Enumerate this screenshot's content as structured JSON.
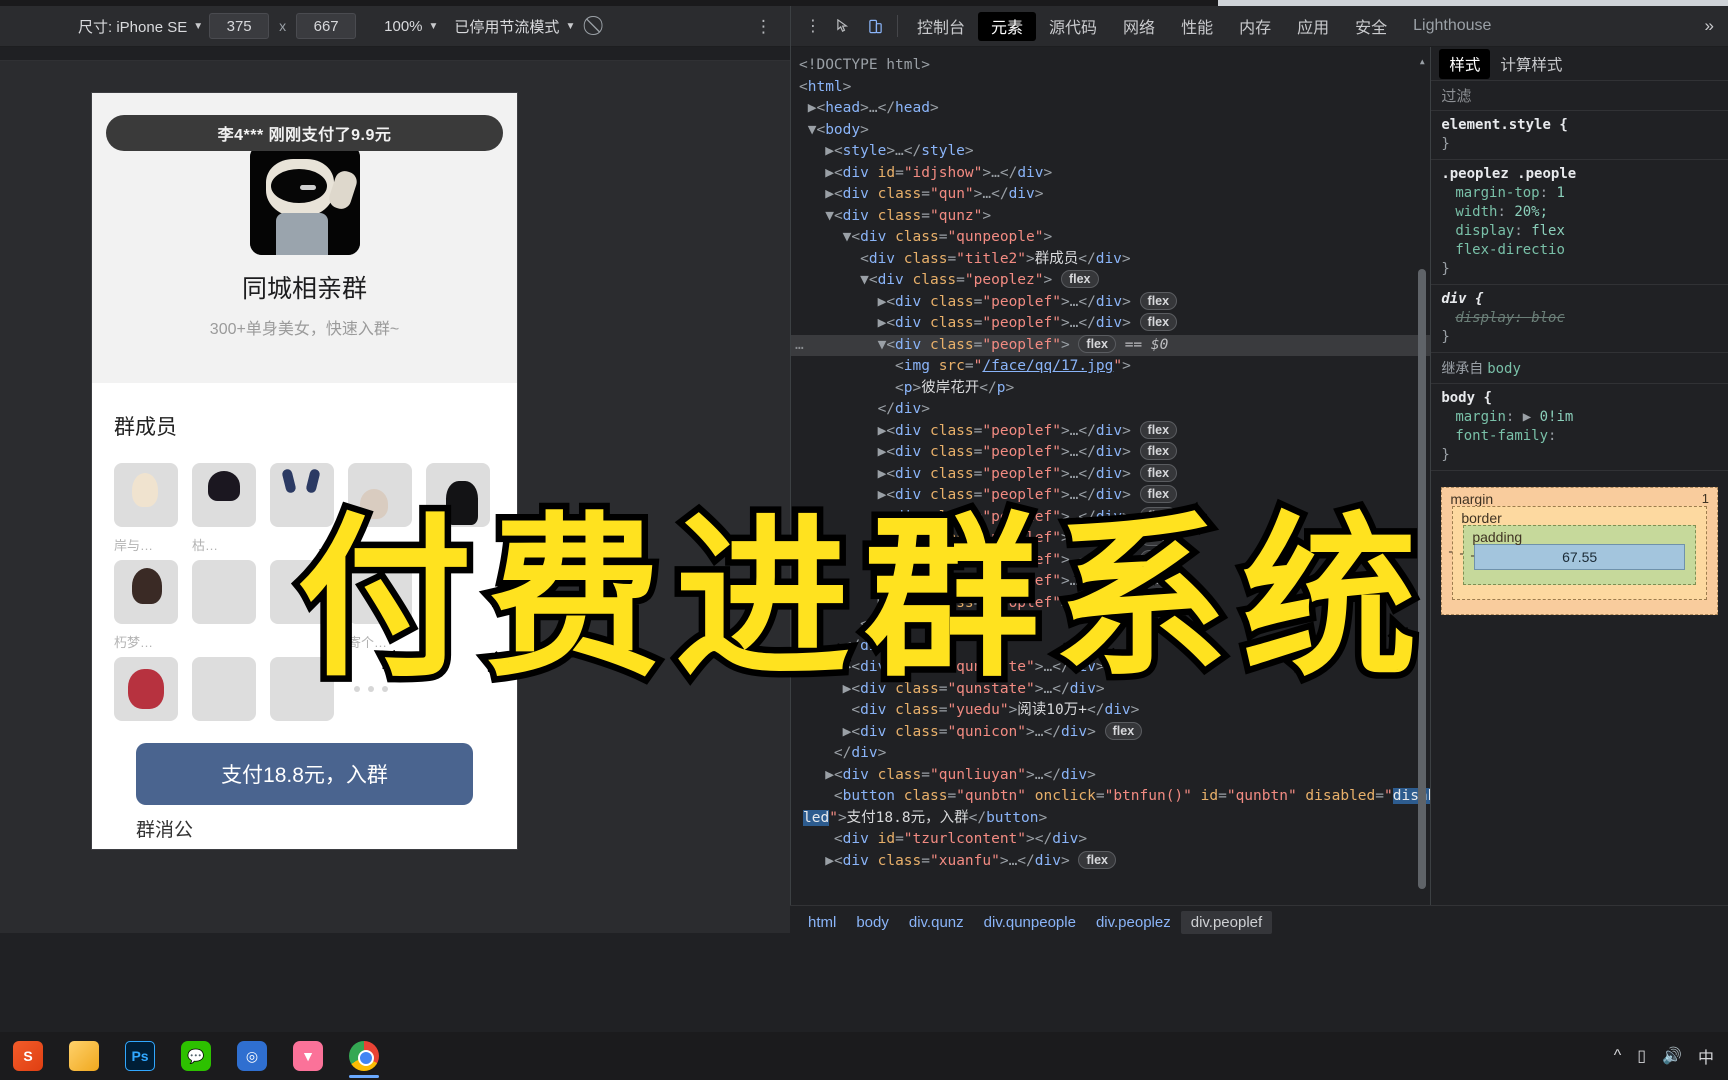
{
  "device_toolbar": {
    "size_label": "尺寸: iPhone SE",
    "width": "375",
    "x_symbol": "x",
    "height": "667",
    "zoom": "100%",
    "throttling": "已停用节流模式",
    "rotate_icon": "rotate-icon",
    "menu_icon": "kebab-menu-icon"
  },
  "devtools": {
    "inspect_icon": "inspect-element-icon",
    "device_icon": "toggle-device-toolbar-icon",
    "tabs": [
      {
        "label": "控制台",
        "selected": false
      },
      {
        "label": "元素",
        "selected": true
      },
      {
        "label": "源代码",
        "selected": false
      },
      {
        "label": "网络",
        "selected": false
      },
      {
        "label": "性能",
        "selected": false
      },
      {
        "label": "内存",
        "selected": false
      },
      {
        "label": "应用",
        "selected": false
      },
      {
        "label": "安全",
        "selected": false
      }
    ],
    "lighthouse_tab": "Lighthouse",
    "more_tabs_icon": "chevron-right-icon",
    "breadcrumb": [
      "html",
      "body",
      "div.qunz",
      "div.qunpeople",
      "div.peoplez",
      "div.peoplef"
    ],
    "breadcrumb_active": "div.peoplef"
  },
  "dom": {
    "lines": [
      "<!DOCTYPE html>",
      "<html>",
      "<head>…</head>",
      "<body>",
      "<style>…</style>",
      "<div id=\"idjshow\">…</div>",
      "<div class=\"qun\">…</div>",
      "<div class=\"qunz\">",
      "<div class=\"qunpeople\">",
      "<div class=\"title2\">群成员</div>",
      "<div class=\"peoplez\"> flex",
      "<div class=\"peoplef\">…</div> flex",
      "<div class=\"peoplef\">…</div> flex",
      "<div class=\"peoplef\"> flex == $0",
      "<img src=\"/face/qq/17.jpg\">",
      "<p>彼岸花开</p>",
      "</div>",
      "<div class=\"peoplef\">…</div> flex",
      "<div class=\"peoplef\">…</div> flex",
      "<div class=\"peoplef\">…</div> flex",
      "<div class=\"peoplef\">…</div> flex",
      "<div class=\"peoplef\">…</div> flex",
      "<div class=\"peoplef\">…</div> flex",
      "<div class=\"peoplef\">…</div> flex",
      "<div class=\"peoplef\">…</div> flex",
      "<div class=\"peoplef\">…</div> flex",
      "</div>",
      "</div>",
      "<div class=\"qunstate\">…</div>",
      "<div class=\"qunstate\">…</div>",
      "<div class=\"yuedu\">阅读10万+</div>",
      "<div class=\"qunicon\">…</div> flex",
      "</div>",
      "<div class=\"qunliuyan\">…</div>",
      "<button class=\"qunbtn\" onclick=\"btnfun()\" id=\"qunbtn\" disabled=\"disabled\">支付18.8元，入群</button>",
      "<div id=\"tzurlcontent\"></div>",
      "<div class=\"xuanfu\">…</div> flex"
    ],
    "selected_text": "<div class=\"peoplef\">",
    "img_src": "/face/qq/17.jpg",
    "p_text": "彼岸花开",
    "title2_text": "群成员",
    "yuedu_text": "阅读10万+",
    "button_text": "支付18.8元，入群",
    "button_disabled_value": "disabled",
    "flex_badge": "flex",
    "dollar_zero": "== $0"
  },
  "styles": {
    "tabs": [
      {
        "label": "样式",
        "selected": true
      },
      {
        "label": "计算样式",
        "selected": false
      }
    ],
    "filter_placeholder": "过滤",
    "rules": [
      {
        "selector": "element.style {",
        "props": [],
        "close": "}"
      },
      {
        "selector": ".peoplez .people",
        "props": [
          {
            "name": "margin-top",
            "value": "1"
          },
          {
            "name": "width",
            "value": "20%;"
          },
          {
            "name": "display",
            "value": "flex"
          },
          {
            "name": "flex-directio",
            "value": ""
          }
        ],
        "close": "}"
      },
      {
        "selector": "div {",
        "props": [
          {
            "name": "display",
            "value": "bloc",
            "struck": true
          }
        ],
        "close": "}"
      }
    ],
    "inherited_label": "继承自",
    "inherited_from": "body",
    "body_rule": {
      "selector": "body {",
      "props": [
        {
          "name": "margin",
          "value": "0!im"
        },
        {
          "name": "font-family",
          "value": ""
        }
      ],
      "close": "}"
    },
    "box_model": {
      "margin_label": "margin",
      "margin_value": "1",
      "border_label": "border",
      "padding_label": "padding",
      "content_value": "67.55",
      "dash": "-"
    }
  },
  "phone": {
    "notice": "李4*** 刚刚支付了9.9元",
    "avatar_icon": "group-avatar-image",
    "group_title": "同城相亲群",
    "group_subtitle": "300+单身美女，快速入群~",
    "members_title": "群成员",
    "members": [
      {
        "name": "岸与…",
        "thumb": "t1"
      },
      {
        "name": "枯…",
        "thumb": "t2"
      },
      {
        "name": "",
        "thumb": "t3"
      },
      {
        "name": "",
        "thumb": "t4"
      },
      {
        "name": "彼岸…",
        "thumb": "t5"
      },
      {
        "name": "朽梦…",
        "thumb": "t6"
      },
      {
        "name": "",
        "thumb": "t7"
      },
      {
        "name": "",
        "thumb": "t8"
      },
      {
        "name": "寄个…",
        "thumb": "t9"
      },
      {
        "name": "",
        "thumb": "t10"
      },
      {
        "name": "",
        "thumb": "t11"
      },
      {
        "name": "",
        "thumb": "t12"
      }
    ],
    "more_dots": "more-dots-icon",
    "pay_button": "支付18.8元，入群",
    "group_notice_label": "群消公"
  },
  "taskbar": {
    "items": [
      {
        "name": "start-button",
        "icon": "start-icon"
      },
      {
        "name": "file-explorer",
        "icon": "folder-icon"
      },
      {
        "name": "photoshop",
        "icon": "ps-icon"
      },
      {
        "name": "wechat",
        "icon": "wechat-icon"
      },
      {
        "name": "app-blue",
        "icon": "blue-app-icon"
      },
      {
        "name": "bilibili",
        "icon": "bilibili-icon"
      },
      {
        "name": "chrome",
        "icon": "chrome-icon"
      }
    ],
    "tray": [
      "^",
      "battery-icon",
      "speaker-icon",
      "中"
    ]
  },
  "watermark": {
    "text": "付费进群系统",
    "color": "#ffe21f"
  }
}
